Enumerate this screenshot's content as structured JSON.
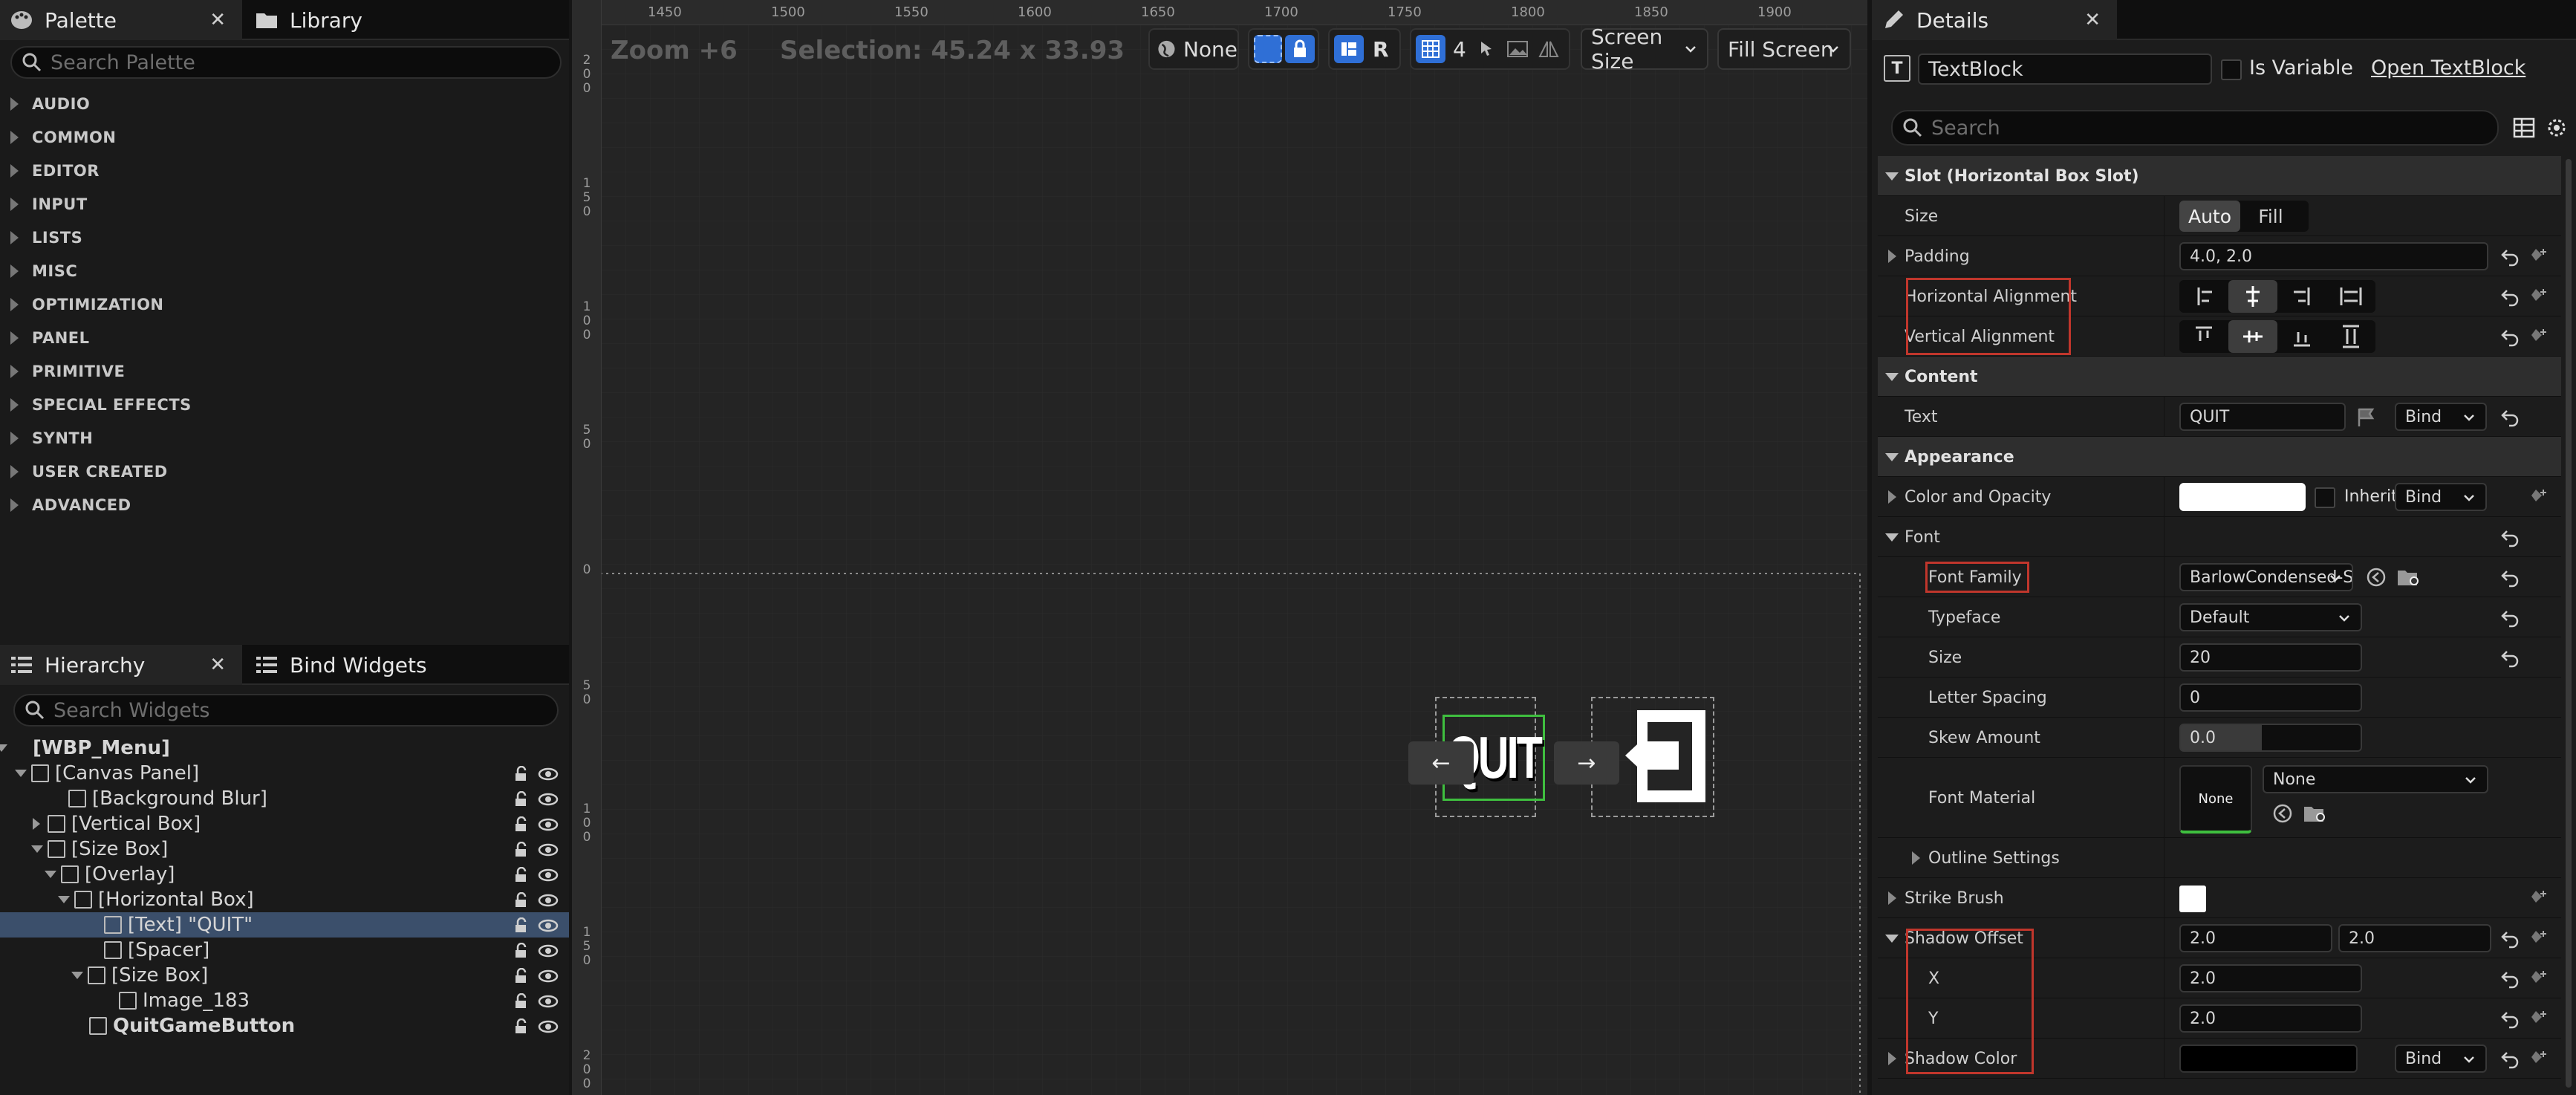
{
  "palette": {
    "tab_label": "Palette",
    "library_tab_label": "Library",
    "search_placeholder": "Search Palette",
    "categories": [
      "AUDIO",
      "COMMON",
      "EDITOR",
      "INPUT",
      "LISTS",
      "MISC",
      "OPTIMIZATION",
      "PANEL",
      "PRIMITIVE",
      "SPECIAL EFFECTS",
      "SYNTH",
      "USER CREATED",
      "ADVANCED"
    ]
  },
  "hierarchy": {
    "tab_label": "Hierarchy",
    "bind_tab_label": "Bind Widgets",
    "search_placeholder": "Search Widgets",
    "items": [
      {
        "label": "[WBP_Menu]",
        "selected": false
      },
      {
        "label": "[Canvas Panel]",
        "selected": false
      },
      {
        "label": "[Background Blur]",
        "selected": false
      },
      {
        "label": "[Vertical Box]",
        "selected": false
      },
      {
        "label": "[Size Box]",
        "selected": false
      },
      {
        "label": "[Overlay]",
        "selected": false
      },
      {
        "label": "[Horizontal Box]",
        "selected": false
      },
      {
        "label": "[Text] \"QUIT\"",
        "selected": true
      },
      {
        "label": "[Spacer]",
        "selected": false
      },
      {
        "label": "[Size Box]",
        "selected": false
      },
      {
        "label": "Image_183",
        "selected": false
      },
      {
        "label": "QuitGameButton",
        "selected": false
      }
    ]
  },
  "viewport": {
    "zoom": "Zoom +6",
    "selection": "Selection: 45.24 x 33.93",
    "ruler_h": [
      "1450",
      "1500",
      "1550",
      "1600",
      "1650",
      "1700",
      "1750",
      "1800",
      "1850",
      "1900"
    ],
    "ruler_v": [
      "200",
      "150",
      "100",
      "50",
      "0",
      "50",
      "100",
      "150",
      "200"
    ],
    "toolbar": {
      "localization": "None",
      "r_label": "R",
      "grid_value": "4",
      "screen_size": "Screen Size",
      "fill_screen": "Fill Screen"
    },
    "widget_text": "QUIT",
    "arrow_left": "←",
    "arrow_right": "→"
  },
  "details": {
    "tab_label": "Details",
    "widget_name": "TextBlock",
    "is_variable_label": "Is Variable",
    "open_link": "Open TextBlock",
    "search_placeholder": "Search",
    "slot_section": "Slot (Horizontal Box Slot)",
    "size_label": "Size",
    "size_auto": "Auto",
    "size_fill": "Fill",
    "padding_label": "Padding",
    "padding_value": "4.0, 2.0",
    "h_align_label": "Horizontal Alignment",
    "v_align_label": "Vertical Alignment",
    "content_section": "Content",
    "text_label": "Text",
    "text_value": "QUIT",
    "bind_label": "Bind",
    "appearance_section": "Appearance",
    "color_opacity_label": "Color and Opacity",
    "inherit_label": "Inherit",
    "font_label": "Font",
    "font_family_label": "Font Family",
    "font_family_value": "BarlowCondensed-Semi",
    "typeface_label": "Typeface",
    "typeface_value": "Default",
    "font_size_label": "Size",
    "font_size_value": "20",
    "letter_spacing_label": "Letter Spacing",
    "letter_spacing_value": "0",
    "skew_label": "Skew Amount",
    "skew_value": "0.0",
    "font_material_label": "Font Material",
    "font_material_thumb": "None",
    "font_material_value": "None",
    "outline_label": "Outline Settings",
    "strike_label": "Strike Brush",
    "shadow_offset_label": "Shadow Offset",
    "shadow_offset_x": "2.0",
    "shadow_offset_y": "2.0",
    "x_label": "X",
    "x_value": "2.0",
    "y_label": "Y",
    "y_value": "2.0",
    "shadow_color_label": "Shadow Color"
  },
  "colors": {
    "selection_blue": "#3b4f6b",
    "highlight_red": "#c0362c",
    "accent_blue": "#2f6fd6",
    "green_outline": "#3fbf3f"
  }
}
